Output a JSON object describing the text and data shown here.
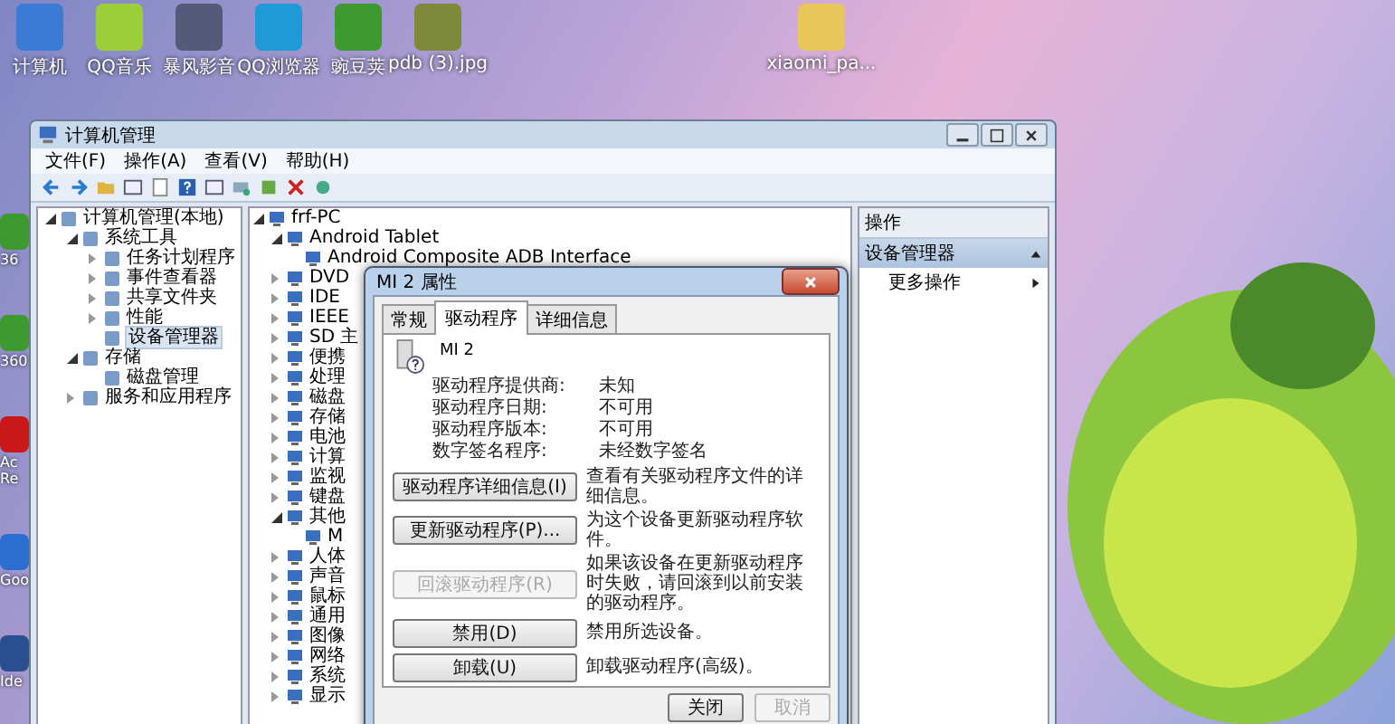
{
  "desktop": {
    "top_icons": [
      {
        "label": "计算机",
        "color": "#3a7bd5"
      },
      {
        "label": "QQ音乐",
        "color": "#9bcf3a"
      },
      {
        "label": "暴风影音",
        "color": "#555a78"
      },
      {
        "label": "QQ浏览器",
        "color": "#1f9ad6"
      },
      {
        "label": "豌豆荚",
        "color": "#3d9a2f"
      },
      {
        "label": "pdb (3).jpg",
        "color": "#7c8a3a"
      },
      {
        "label": "xiaomi_pa...",
        "color": "#e8c65a"
      }
    ],
    "left_icons": [
      {
        "label": "36",
        "color": "#3d9a2f"
      },
      {
        "label": "360",
        "color": "#3d9a2f"
      },
      {
        "label": "Ac Re",
        "color": "#c81818"
      },
      {
        "label": "Goo",
        "color": "#2a6fd0"
      },
      {
        "label": "Ide",
        "color": "#2a4f90"
      }
    ]
  },
  "window": {
    "title": "计算机管理",
    "menu": [
      "文件(F)",
      "操作(A)",
      "查看(V)",
      "帮助(H)"
    ],
    "nav_tree": [
      {
        "label": "计算机管理(本地)",
        "expanded": true,
        "selected": false,
        "children": [
          {
            "label": "系统工具",
            "expanded": true,
            "selected": false,
            "children": [
              {
                "label": "任务计划程序",
                "expanded": false,
                "selected": false
              },
              {
                "label": "事件查看器",
                "expanded": false,
                "selected": false
              },
              {
                "label": "共享文件夹",
                "expanded": false,
                "selected": false
              },
              {
                "label": "性能",
                "expanded": false,
                "selected": false
              },
              {
                "label": "设备管理器",
                "selected": true
              }
            ]
          },
          {
            "label": "存储",
            "expanded": true,
            "selected": false,
            "children": [
              {
                "label": "磁盘管理",
                "selected": false
              }
            ]
          },
          {
            "label": "服务和应用程序",
            "expanded": false,
            "selected": false
          }
        ]
      }
    ],
    "device_tree": [
      {
        "label": "frf-PC",
        "expanded": true,
        "children": [
          {
            "label": "Android Tablet",
            "expanded": true,
            "children": [
              {
                "label": "Android Composite ADB Interface"
              }
            ]
          },
          {
            "label": "DVD",
            "expanded": false
          },
          {
            "label": "IDE",
            "expanded": false
          },
          {
            "label": "IEEE",
            "expanded": false
          },
          {
            "label": "SD 主",
            "expanded": false
          },
          {
            "label": "便携",
            "expanded": false
          },
          {
            "label": "处理",
            "expanded": false
          },
          {
            "label": "磁盘",
            "expanded": false
          },
          {
            "label": "存储",
            "expanded": false
          },
          {
            "label": "电池",
            "expanded": false
          },
          {
            "label": "计算",
            "expanded": false
          },
          {
            "label": "监视",
            "expanded": false
          },
          {
            "label": "键盘",
            "expanded": false
          },
          {
            "label": "其他",
            "expanded": true,
            "children": [
              {
                "label": "M"
              }
            ]
          },
          {
            "label": "人体",
            "expanded": false
          },
          {
            "label": "声音",
            "expanded": false
          },
          {
            "label": "鼠标",
            "expanded": false
          },
          {
            "label": "通用",
            "expanded": false
          },
          {
            "label": "图像",
            "expanded": false
          },
          {
            "label": "网络",
            "expanded": false
          },
          {
            "label": "系统",
            "expanded": false
          },
          {
            "label": "显示",
            "expanded": false
          }
        ]
      }
    ],
    "actions": {
      "header": "操作",
      "section": "设备管理器",
      "items": [
        "更多操作"
      ]
    }
  },
  "dialog": {
    "title": "MI 2 属性",
    "tabs": [
      {
        "label": "常规",
        "selected": false
      },
      {
        "label": "驱动程序",
        "selected": true
      },
      {
        "label": "详细信息",
        "selected": false
      }
    ],
    "device_name": "MI 2",
    "info": [
      {
        "label": "驱动程序提供商:",
        "value": "未知"
      },
      {
        "label": "驱动程序日期:",
        "value": "不可用"
      },
      {
        "label": "驱动程序版本:",
        "value": "不可用"
      },
      {
        "label": "数字签名程序:",
        "value": "未经数字签名"
      }
    ],
    "actions": [
      {
        "button": "驱动程序详细信息(I)",
        "description": "查看有关驱动程序文件的详细信息。",
        "disabled": false
      },
      {
        "button": "更新驱动程序(P)...",
        "description": "为这个设备更新驱动程序软件。",
        "disabled": false
      },
      {
        "button": "回滚驱动程序(R)",
        "description": "如果该设备在更新驱动程序时失败，请回滚到以前安装的驱动程序。",
        "disabled": true
      },
      {
        "button": "禁用(D)",
        "description": "禁用所选设备。",
        "disabled": false
      },
      {
        "button": "卸载(U)",
        "description": "卸载驱动程序(高级)。",
        "disabled": false
      }
    ],
    "footer": [
      {
        "label": "关闭",
        "disabled": false
      },
      {
        "label": "取消",
        "disabled": true
      }
    ]
  }
}
